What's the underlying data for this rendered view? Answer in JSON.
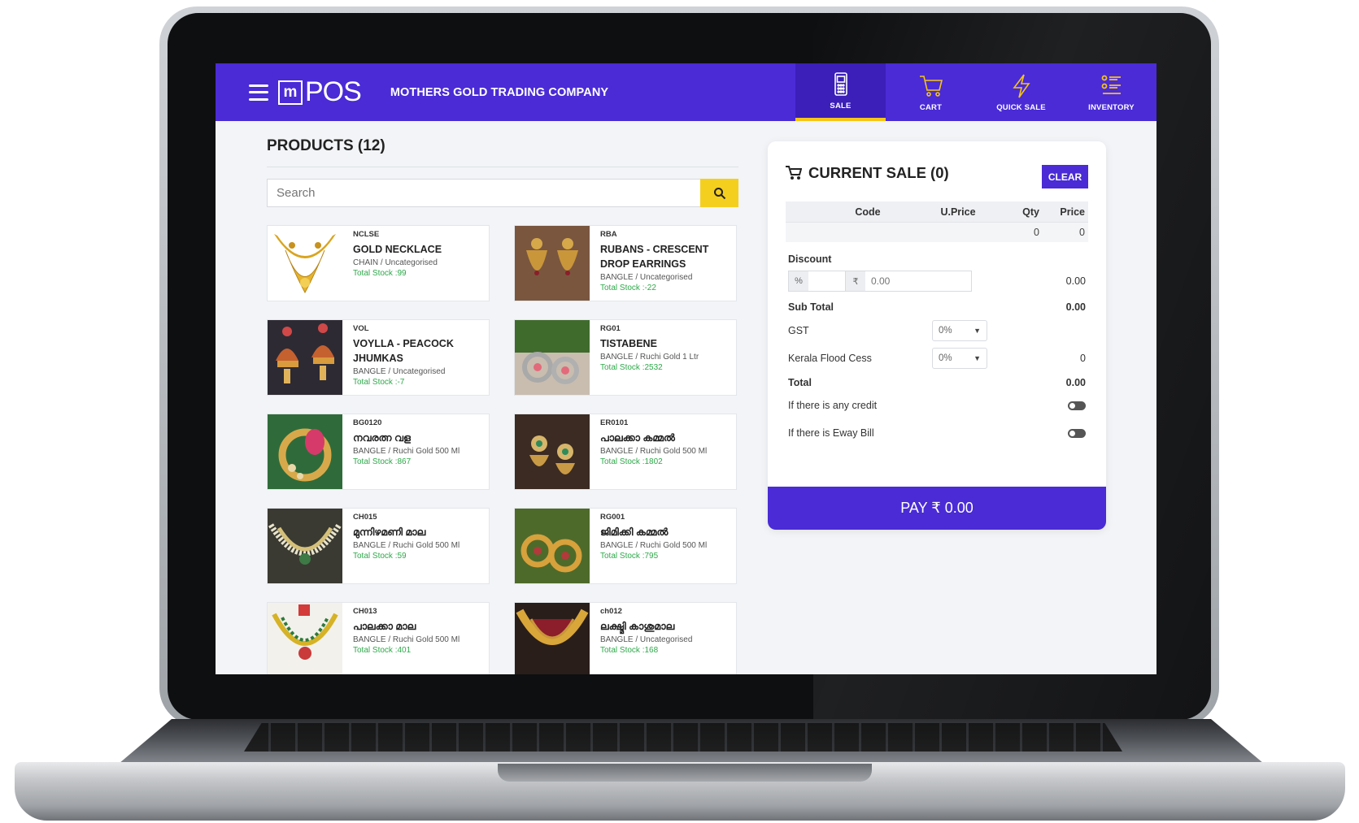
{
  "app": {
    "logo_mark": "m",
    "logo_text": "POS",
    "company": "MOTHERS GOLD TRADING COMPANY",
    "accent": "#4a2bd6",
    "highlight": "#f5c518"
  },
  "nav": [
    {
      "label": "SALE",
      "icon": "pos-terminal-icon",
      "active": true
    },
    {
      "label": "CART",
      "icon": "cart-icon",
      "active": false
    },
    {
      "label": "QUICK SALE",
      "icon": "lightning-icon",
      "active": false
    },
    {
      "label": "INVENTORY",
      "icon": "list-icon",
      "active": false
    }
  ],
  "products": {
    "title": "PRODUCTS (12)",
    "search_placeholder": "Search",
    "items": [
      {
        "code": "NCLSE",
        "name": "GOLD NECKLACE",
        "category": "CHAIN / Uncategorised",
        "stock": "Total Stock :99"
      },
      {
        "code": "RBA",
        "name": "RUBANS - CRESCENT DROP EARRINGS",
        "category": "BANGLE / Uncategorised",
        "stock": "Total Stock :-22"
      },
      {
        "code": "VOL",
        "name": "VOYLLA - PEACOCK JHUMKAS",
        "category": "BANGLE / Uncategorised",
        "stock": "Total Stock :-7"
      },
      {
        "code": "RG01",
        "name": "TISTABENE",
        "category": "BANGLE / Ruchi Gold 1 Ltr",
        "stock": "Total Stock :2532"
      },
      {
        "code": "BG0120",
        "name": "നവരത്ന വള",
        "category": "BANGLE / Ruchi Gold 500 Ml",
        "stock": "Total Stock :867"
      },
      {
        "code": "ER0101",
        "name": "പാലക്കാ കമ്മൽ",
        "category": "BANGLE / Ruchi Gold 500 Ml",
        "stock": "Total Stock :1802"
      },
      {
        "code": "CH015",
        "name": "മുന്നിഴമണി മാല",
        "category": "BANGLE / Ruchi Gold 500 Ml",
        "stock": "Total Stock :59"
      },
      {
        "code": "RG001",
        "name": "ജിമിക്കി കമ്മൽ",
        "category": "BANGLE / Ruchi Gold 500 Ml",
        "stock": "Total Stock :795"
      },
      {
        "code": "CH013",
        "name": "പാലക്കാ മാല",
        "category": "BANGLE / Ruchi Gold 500 Ml",
        "stock": "Total Stock :401"
      },
      {
        "code": "ch012",
        "name": "ലക്ഷ്മി കാശുമാല",
        "category": "BANGLE / Uncategorised",
        "stock": "Total Stock :168"
      }
    ]
  },
  "sale": {
    "title": "CURRENT SALE (0)",
    "clear_label": "CLEAR",
    "columns": {
      "code": "Code",
      "uprice": "U.Price",
      "qty": "Qty",
      "price": "Price"
    },
    "row": {
      "code": "",
      "uprice": "",
      "qty": "0",
      "price": "0"
    },
    "discount_label": "Discount",
    "discount_pct_addon": "%",
    "discount_rupee_addon": "₹",
    "discount_placeholder": "0.00",
    "discount_amount": "0.00",
    "subtotal_label": "Sub Total",
    "subtotal_value": "0.00",
    "gst_label": "GST",
    "gst_value": "0%",
    "cess_label": "Kerala Flood Cess",
    "cess_value": "0%",
    "cess_amount": "0",
    "total_label": "Total",
    "total_value": "0.00",
    "credit_label": "If there is any credit",
    "eway_label": "If there is Eway Bill",
    "pay_label": "PAY ₹ 0.00"
  }
}
